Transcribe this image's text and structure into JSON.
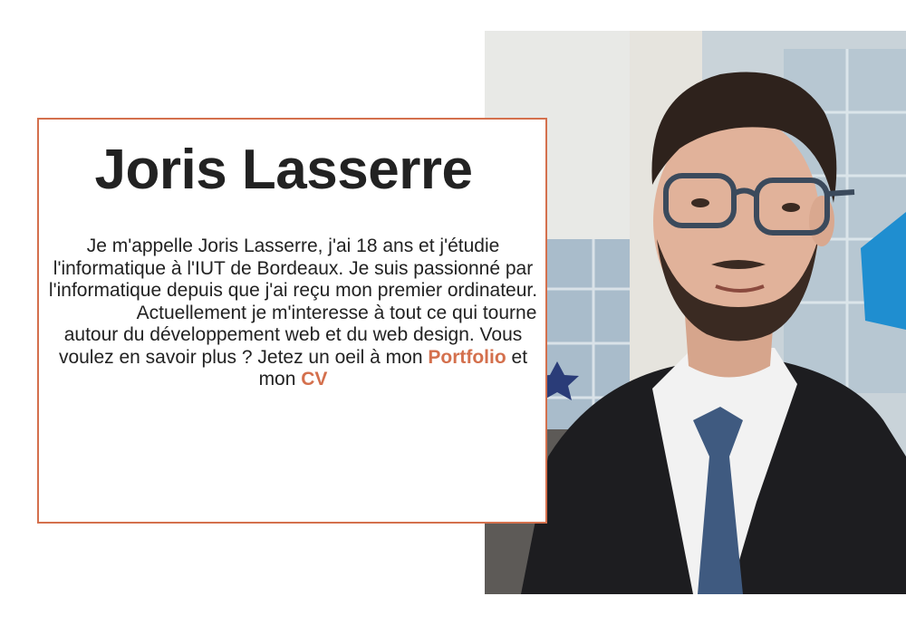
{
  "profile": {
    "name": "Joris Lasserre",
    "bio_p1": "Je m'appelle Joris Lasserre, j'ai 18 ans et j'étudie l'informatique à l'IUT de Bordeaux. Je suis passionné par l'informatique depuis que j'ai reçu mon premier ordinateur.",
    "bio_p2_before": "Actuellement je m'interesse à tout ce qui tourne autour du développement web et du web design. Vous voulez en savoir plus ? Jetez un oeil à mon ",
    "portfolio_link": "Portfolio",
    "bio_p2_middle": " et mon ",
    "cv_link": "CV"
  },
  "colors": {
    "accent": "#d4704d",
    "text": "#222222",
    "background": "#ffffff"
  }
}
